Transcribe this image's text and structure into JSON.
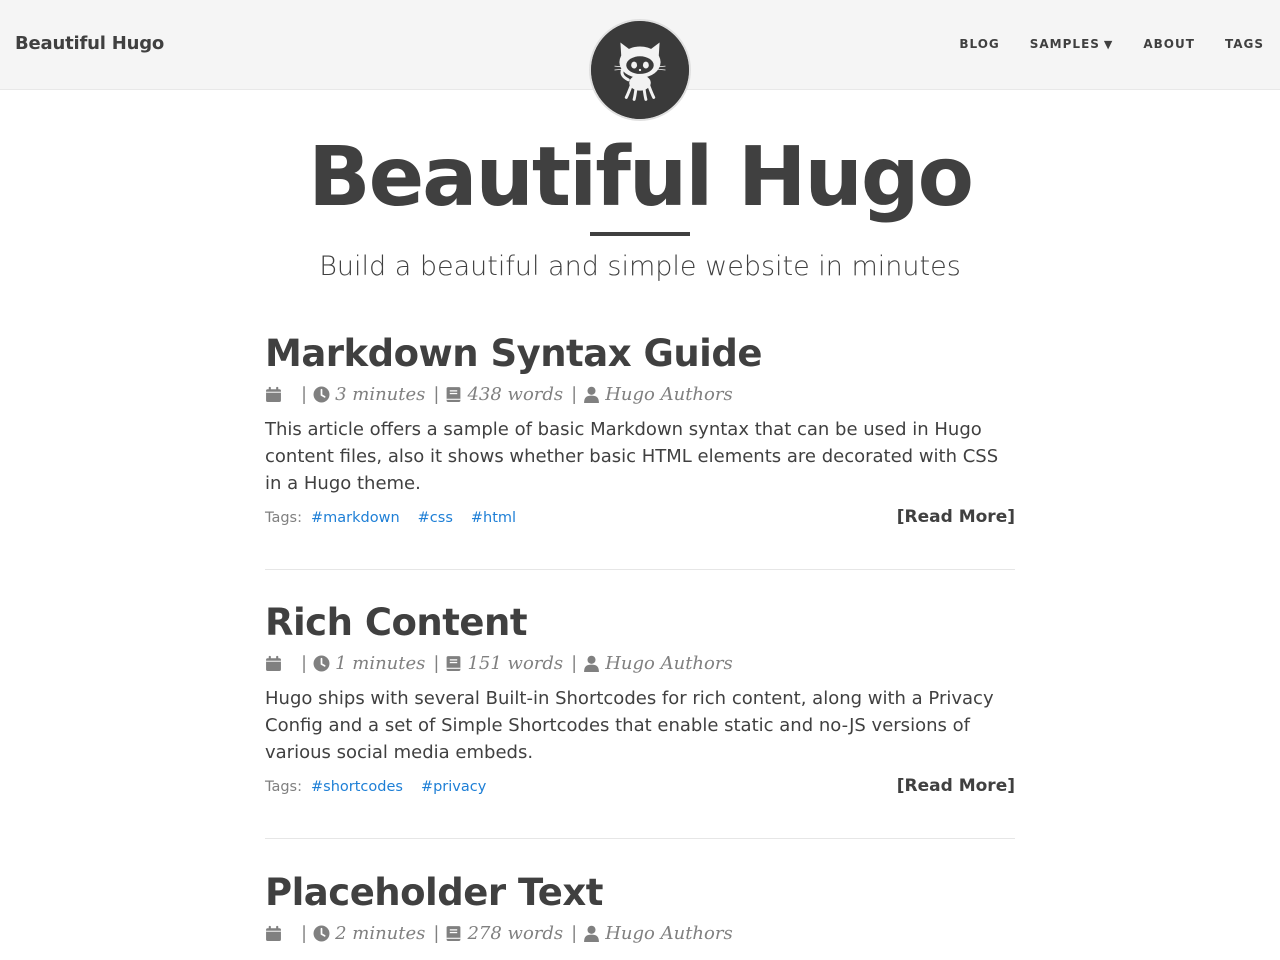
{
  "navbar": {
    "brand": "Beautiful Hugo",
    "links": [
      {
        "label": "BLOG"
      },
      {
        "label": "SAMPLES",
        "caret": "▼"
      },
      {
        "label": "ABOUT"
      },
      {
        "label": "TAGS"
      }
    ]
  },
  "hero": {
    "title": "Beautiful Hugo",
    "subtitle": "Build a beautiful and simple website in minutes"
  },
  "posts": [
    {
      "title": "Markdown Syntax Guide",
      "reading_time": "3 minutes",
      "word_count": "438 words",
      "author": "Hugo Authors",
      "summary": "This article offers a sample of basic Markdown syntax that can be used in Hugo content files, also it shows whether basic HTML elements are decorated with CSS in a Hugo theme.",
      "tags_label": "Tags:",
      "tags": [
        "#markdown",
        "#css",
        "#html"
      ],
      "read_more": "[Read More]"
    },
    {
      "title": "Rich Content",
      "reading_time": "1 minutes",
      "word_count": "151 words",
      "author": "Hugo Authors",
      "summary": "Hugo ships with several Built-in Shortcodes for rich content, along with a Privacy Config and a set of Simple Shortcodes that enable static and no-JS versions of various social media embeds.",
      "tags_label": "Tags:",
      "tags": [
        "#shortcodes",
        "#privacy"
      ],
      "read_more": "[Read More]"
    },
    {
      "title": "Placeholder Text",
      "reading_time": "2 minutes",
      "word_count": "278 words",
      "author": "Hugo Authors"
    }
  ],
  "meta_separator": "|",
  "colors": {
    "text": "#404040",
    "muted": "#808080",
    "tag_link": "#1e7fd6",
    "navbar_bg": "#f5f5f5"
  },
  "icons": {
    "avatar": "github-octocat-icon",
    "date": "calendar-icon",
    "time": "clock-icon",
    "words": "book-icon",
    "author": "user-icon"
  }
}
